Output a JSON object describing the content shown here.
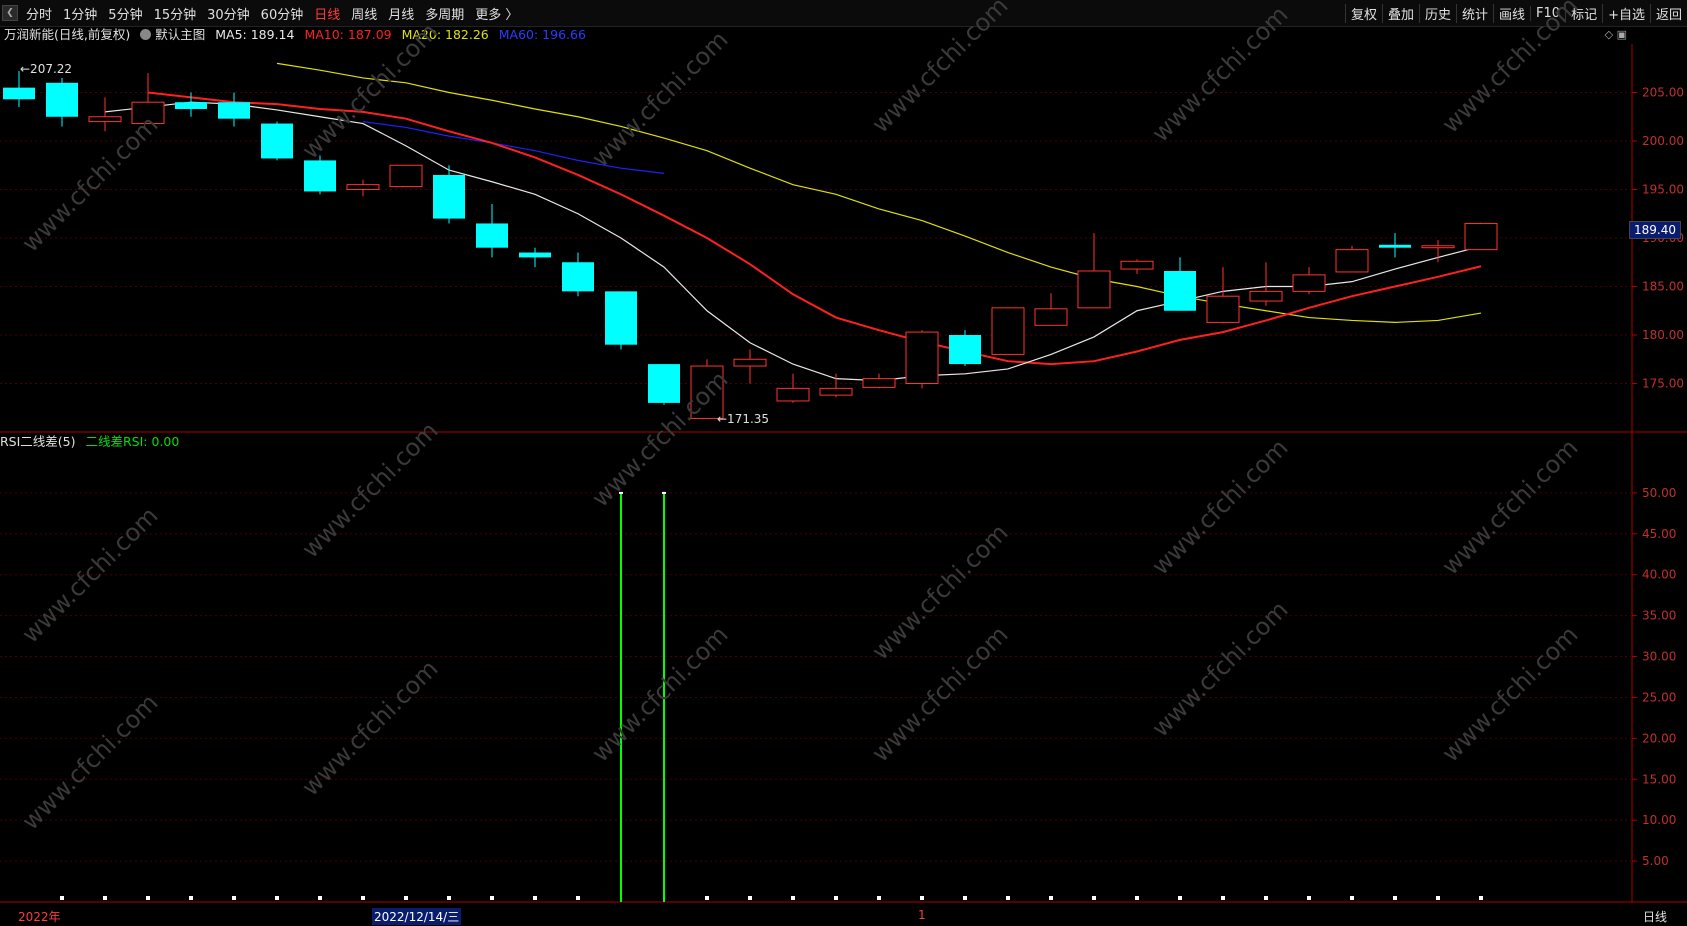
{
  "toolbar": {
    "back_icon": "chevron-left-icon",
    "periods": [
      "分时",
      "1分钟",
      "5分钟",
      "15分钟",
      "30分钟",
      "60分钟",
      "日线",
      "周线",
      "月线",
      "多周期",
      "更多 〉"
    ],
    "active_period": "日线",
    "tools": [
      "复权",
      "叠加",
      "历史",
      "统计",
      "画线",
      "F10",
      "标记",
      "+自选",
      "返回"
    ]
  },
  "main_legend": {
    "stock": "万润新能",
    "mode": "(日线,前复权)",
    "chart_name": "默认主图",
    "ma5": "MA5: 189.14",
    "ma10": "MA10: 187.09",
    "ma20": "MA20: 182.26",
    "ma60": "MA60: 196.66"
  },
  "indicator_legend": {
    "name": "RSI二线差(5)",
    "value": "二线差RSI: 0.00"
  },
  "price_tag": "189.40",
  "high_label": "207.22",
  "low_label": "171.35",
  "price_axis": [
    "205.00",
    "200.00",
    "195.00",
    "190.00",
    "185.00",
    "180.00",
    "175.00"
  ],
  "indicator_axis": [
    "50.00",
    "45.00",
    "40.00",
    "35.00",
    "30.00",
    "25.00",
    "20.00",
    "15.00",
    "10.00",
    "5.00"
  ],
  "bottom": {
    "year": "2022年",
    "date": "2022/12/14/三",
    "marker": "1",
    "period": "日线"
  },
  "watermark": "www.cfchi.com",
  "colors": {
    "up": "#ff3232",
    "down": "#00ffff",
    "ma5": "#e8e8e8",
    "ma10": "#ff2020",
    "ma20": "#e0e000",
    "ma60": "#2020ff",
    "rsi": "#00ff00",
    "axis": "#b00000"
  },
  "chart_data": {
    "type": "candlestick",
    "candles": [
      {
        "o": 205.5,
        "h": 207.2,
        "l": 203.5,
        "c": 204.3
      },
      {
        "o": 206.0,
        "h": 206.5,
        "l": 201.5,
        "c": 202.5
      },
      {
        "o": 202.0,
        "h": 204.5,
        "l": 201.0,
        "c": 202.5
      },
      {
        "o": 201.8,
        "h": 207.0,
        "l": 201.8,
        "c": 204.0
      },
      {
        "o": 204.0,
        "h": 205.0,
        "l": 202.5,
        "c": 203.3
      },
      {
        "o": 204.0,
        "h": 205.0,
        "l": 201.5,
        "c": 202.3
      },
      {
        "o": 201.8,
        "h": 202.0,
        "l": 198.0,
        "c": 198.2
      },
      {
        "o": 198.0,
        "h": 198.5,
        "l": 194.5,
        "c": 194.8
      },
      {
        "o": 195.0,
        "h": 196.0,
        "l": 194.3,
        "c": 195.5
      },
      {
        "o": 195.3,
        "h": 197.5,
        "l": 195.3,
        "c": 197.5
      },
      {
        "o": 196.5,
        "h": 197.5,
        "l": 191.5,
        "c": 192.0
      },
      {
        "o": 191.5,
        "h": 193.5,
        "l": 188.0,
        "c": 189.0
      },
      {
        "o": 188.5,
        "h": 189.0,
        "l": 187.0,
        "c": 188.0
      },
      {
        "o": 187.5,
        "h": 188.5,
        "l": 184.0,
        "c": 184.5
      },
      {
        "o": 184.5,
        "h": 184.5,
        "l": 178.5,
        "c": 179.0
      },
      {
        "o": 177.0,
        "h": 177.0,
        "l": 172.8,
        "c": 173.0
      },
      {
        "o": 171.4,
        "h": 177.5,
        "l": 171.4,
        "c": 176.8
      },
      {
        "o": 176.8,
        "h": 178.5,
        "l": 175.0,
        "c": 177.5
      },
      {
        "o": 173.2,
        "h": 176.0,
        "l": 173.0,
        "c": 174.5
      },
      {
        "o": 173.8,
        "h": 176.0,
        "l": 173.6,
        "c": 174.5
      },
      {
        "o": 174.6,
        "h": 176.0,
        "l": 174.5,
        "c": 175.5
      },
      {
        "o": 175.0,
        "h": 180.5,
        "l": 174.5,
        "c": 180.3
      },
      {
        "o": 180.0,
        "h": 180.5,
        "l": 176.8,
        "c": 177.0
      },
      {
        "o": 178.0,
        "h": 182.8,
        "l": 178.0,
        "c": 182.8
      },
      {
        "o": 181.0,
        "h": 184.3,
        "l": 181.0,
        "c": 182.7
      },
      {
        "o": 182.8,
        "h": 190.5,
        "l": 182.8,
        "c": 186.6
      },
      {
        "o": 186.8,
        "h": 187.8,
        "l": 186.3,
        "c": 187.6
      },
      {
        "o": 186.6,
        "h": 188.0,
        "l": 182.5,
        "c": 182.5
      },
      {
        "o": 181.3,
        "h": 187.0,
        "l": 181.2,
        "c": 184.0
      },
      {
        "o": 183.5,
        "h": 187.5,
        "l": 183.0,
        "c": 184.5
      },
      {
        "o": 184.5,
        "h": 187.0,
        "l": 184.2,
        "c": 186.2
      },
      {
        "o": 186.5,
        "h": 189.2,
        "l": 186.5,
        "c": 188.8
      },
      {
        "o": 189.3,
        "h": 190.5,
        "l": 188.0,
        "c": 189.0
      },
      {
        "o": 189.0,
        "h": 189.8,
        "l": 187.5,
        "c": 189.2
      },
      {
        "o": 188.8,
        "h": 191.6,
        "l": 188.8,
        "c": 191.5
      }
    ],
    "ma5": [
      203.0,
      203.5,
      204.0,
      203.8,
      203.2,
      202.5,
      201.8,
      199.5,
      197.0,
      195.8,
      194.5,
      192.5,
      190.0,
      187.0,
      182.5,
      179.2,
      177.0,
      175.5,
      175.3,
      175.8,
      176.0,
      176.5,
      178.0,
      179.8,
      182.5,
      183.5,
      184.5,
      185.0,
      185.0,
      185.5,
      186.8,
      188.0,
      189.14
    ],
    "ma10": [
      205.0,
      204.5,
      204.0,
      203.8,
      203.3,
      203.0,
      202.3,
      201.0,
      199.8,
      198.3,
      196.5,
      194.5,
      192.3,
      190.0,
      187.3,
      184.2,
      181.8,
      180.5,
      179.3,
      178.3,
      177.3,
      177.0,
      177.3,
      178.3,
      179.5,
      180.3,
      181.5,
      182.8,
      184.0,
      185.0,
      186.0,
      187.09
    ],
    "ma20": [
      208.0,
      207.3,
      206.5,
      206.0,
      205.0,
      204.2,
      203.3,
      202.5,
      201.5,
      200.3,
      199.0,
      197.2,
      195.5,
      194.5,
      193.0,
      191.8,
      190.2,
      188.5,
      187.0,
      185.8,
      185.0,
      184.0,
      183.2,
      182.5,
      181.8,
      181.5,
      181.3,
      181.5,
      182.26
    ],
    "ma60": [
      202.0,
      201.4,
      200.5,
      199.8,
      199.0,
      198.0,
      197.2,
      196.66
    ],
    "rsi_spikes": [
      {
        "index": 14,
        "value": 50.0
      },
      {
        "index": 15,
        "value": 50.0
      }
    ]
  }
}
